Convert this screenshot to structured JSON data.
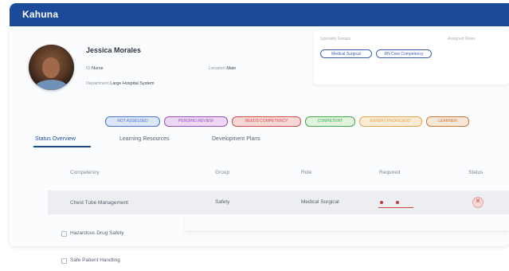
{
  "app": {
    "brand": "Kahuna"
  },
  "profile": {
    "name": "Jessica Morales",
    "fields": [
      {
        "label": "ID",
        "value": "Nurse"
      },
      {
        "label": "Location",
        "value": "Main"
      },
      {
        "label": "Department",
        "value": "Large Hospital System"
      }
    ]
  },
  "assignments": {
    "left_label": "Specialty Groups",
    "right_label": "Assigned Roles",
    "chips": [
      "Medical Surgical",
      "RN Core Competency"
    ]
  },
  "status_filters": [
    {
      "label": "NOT ASSESSED",
      "color": "#4a74c9",
      "bg": "#dbe6fa"
    },
    {
      "label": "PENDING REVIEW",
      "color": "#9a4fb8",
      "bg": "#ecd8f5"
    },
    {
      "label": "NEEDS COMPETENCY",
      "color": "#d24b4b",
      "bg": "#f8d7d7"
    },
    {
      "label": "COMPETENT",
      "color": "#47a84a",
      "bg": "#dff3df"
    },
    {
      "label": "EXPERT PROFICIENT",
      "color": "#e2a34a",
      "bg": "#fbecd6"
    },
    {
      "label": "LEARNER",
      "color": "#c57a3a",
      "bg": "#f8e6d6"
    }
  ],
  "tabs": [
    "Status Overview",
    "Learning Resources",
    "Development Plans"
  ],
  "table": {
    "headers": [
      "Competency",
      "Group",
      "Role",
      "Required",
      "Status"
    ],
    "rows": [
      {
        "competency": "Chest Tube Management",
        "group": "Safety",
        "role": "Medical Surgical"
      },
      {
        "competency": "Hazardous Drug Safety"
      },
      {
        "competency": "Safe Patient Handling"
      }
    ]
  }
}
